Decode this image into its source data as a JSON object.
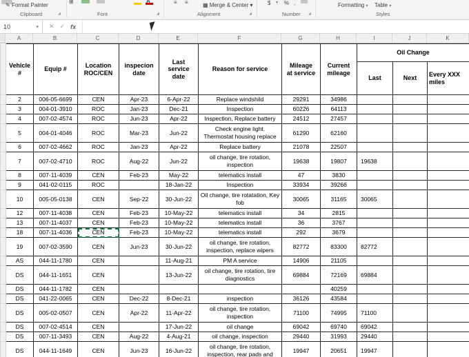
{
  "colors": {
    "copy_border": "#107c41",
    "grid_border": "#262626"
  },
  "ribbon": {
    "format_painter": "Format Painter",
    "merge_center": "Merge & Center",
    "formatting": "Formatting",
    "table_btn": "Table",
    "groups": {
      "clipboard": "Clipboard",
      "font": "Font",
      "alignment": "Alignment",
      "number": "Number",
      "styles": "Styles"
    },
    "icons": {
      "brush": "✎",
      "caret": "▾",
      "merge": "▦",
      "borders": "⊞",
      "align": "≡",
      "currency": "$",
      "percent": "%",
      "comma": ",",
      "launcher": "◢",
      "font_color": "A"
    }
  },
  "formula_bar": {
    "name_box": "10",
    "cancel": "✕",
    "enter": "✓",
    "fx": "fx"
  },
  "columns": [
    "A",
    "B",
    "C",
    "D",
    "E",
    "F",
    "G",
    "H",
    "I",
    "J",
    "K"
  ],
  "table": {
    "headers": {
      "vehicle": "Vehicle #",
      "equip": "Equip #",
      "location": "Location\nROC/CEN",
      "inspection": "inspecion\ndate",
      "last_service": "Last\nservice\ndate",
      "reason": "Reason for service",
      "mileage_at_service": "Mileage\nat service",
      "current_mileage": "Current\nmileage",
      "oil_change": "Oil Change",
      "oil_last": "Last",
      "oil_next": "Next",
      "oil_every": "Every XXX\nmiles"
    },
    "rows": [
      {
        "vehicle": "2",
        "equip": "006-05-6699",
        "location": "CEN",
        "inspection": "Apr-23",
        "last_service": "6-Apr-22",
        "reason": "Replace windshild",
        "mileage_at_service": "29291",
        "current_mileage": "34986",
        "oil_last": "",
        "oil_next": "",
        "oil_every": "",
        "tall": false
      },
      {
        "vehicle": "3",
        "equip": "004-01-3910",
        "location": "ROC",
        "inspection": "Jan-23",
        "last_service": "Dec-21",
        "reason": "Inspection",
        "mileage_at_service": "60226",
        "current_mileage": "64113",
        "oil_last": "",
        "oil_next": "",
        "oil_every": "",
        "tall": false
      },
      {
        "vehicle": "4",
        "equip": "007-02-4574",
        "location": "ROC",
        "inspection": "Jun-23",
        "last_service": "Apr-22",
        "reason": "Inspection, Replace battery",
        "mileage_at_service": "24512",
        "current_mileage": "27457",
        "oil_last": "",
        "oil_next": "",
        "oil_every": "",
        "tall": false
      },
      {
        "vehicle": "5",
        "equip": "004-01-4046",
        "location": "ROC",
        "inspection": "Mar-23",
        "last_service": "Jun-22",
        "reason": "Check engine light. Thermostat housing replace",
        "mileage_at_service": "61290",
        "current_mileage": "62160",
        "oil_last": "",
        "oil_next": "",
        "oil_every": "",
        "tall": true
      },
      {
        "vehicle": "6",
        "equip": "007-02-4662",
        "location": "ROC",
        "inspection": "Jan-23",
        "last_service": "Apr-22",
        "reason": "Replace battery",
        "mileage_at_service": "21078",
        "current_mileage": "22507",
        "oil_last": "",
        "oil_next": "",
        "oil_every": "",
        "tall": false
      },
      {
        "vehicle": "7",
        "equip": "007-02-4710",
        "location": "ROC",
        "inspection": "Aug-22",
        "last_service": "Jun-22",
        "reason": "oil change, tire rotation, inspection",
        "mileage_at_service": "19638",
        "current_mileage": "19807",
        "oil_last": "19638",
        "oil_next": "",
        "oil_every": "",
        "tall": true
      },
      {
        "vehicle": "8",
        "equip": "007-11-4039",
        "location": "CEN",
        "inspection": "Feb-23",
        "last_service": "May-22",
        "reason": "telematics install",
        "mileage_at_service": "47",
        "current_mileage": "3830",
        "oil_last": "",
        "oil_next": "",
        "oil_every": "",
        "tall": false
      },
      {
        "vehicle": "9",
        "equip": "041-02-0115",
        "location": "ROC",
        "inspection": "",
        "last_service": "18-Jan-22",
        "reason": "Inspection",
        "mileage_at_service": "33934",
        "current_mileage": "39266",
        "oil_last": "",
        "oil_next": "",
        "oil_every": "",
        "tall": false
      },
      {
        "vehicle": "10",
        "equip": "005-05-0138",
        "location": "CEN",
        "inspection": "Sep-22",
        "last_service": "30-Jun-22",
        "reason": "Oil change, tire rotatation, Key fob",
        "mileage_at_service": "30065",
        "current_mileage": "31165",
        "oil_last": "30065",
        "oil_next": "",
        "oil_every": "",
        "tall": true
      },
      {
        "vehicle": "12",
        "equip": "007-11-4038",
        "location": "CEN",
        "inspection": "Feb-23",
        "last_service": "10-May-22",
        "reason": "telematics install",
        "mileage_at_service": "34",
        "current_mileage": "2815",
        "oil_last": "",
        "oil_next": "",
        "oil_every": "",
        "tall": false
      },
      {
        "vehicle": "13",
        "equip": "007-11-4037",
        "location": "CEN",
        "inspection": "Feb-23",
        "last_service": "10-May-22",
        "reason": "telematics install",
        "mileage_at_service": "36",
        "current_mileage": "3767",
        "oil_last": "",
        "oil_next": "",
        "oil_every": "",
        "tall": false
      },
      {
        "vehicle": "18",
        "equip": "007-11-4036",
        "location": "CEN",
        "inspection": "Feb-23",
        "last_service": "10-May-22",
        "reason": "telematics install",
        "mileage_at_service": "292",
        "current_mileage": "3679",
        "oil_last": "",
        "oil_next": "",
        "oil_every": "",
        "tall": false,
        "copied": "location"
      },
      {
        "vehicle": "19",
        "equip": "007-02-3590",
        "location": "CEN",
        "inspection": "Jun-23",
        "last_service": "30-Jun-22",
        "reason": "oil change, tire rotation, inspection, replace wipers",
        "mileage_at_service": "82772",
        "current_mileage": "83300",
        "oil_last": "82772",
        "oil_next": "",
        "oil_every": "",
        "tall": true
      },
      {
        "vehicle": "AS",
        "equip": "044-11-1780",
        "location": "CEN",
        "inspection": "",
        "last_service": "11-Aug-21",
        "reason": "PM A service",
        "mileage_at_service": "14906",
        "current_mileage": "21105",
        "oil_last": "",
        "oil_next": "",
        "oil_every": "",
        "tall": false
      },
      {
        "vehicle": "DS",
        "equip": "044-11-1651",
        "location": "CEN",
        "inspection": "",
        "last_service": "13-Jun-22",
        "reason": "oil change, tire rotation, tire diagnostics",
        "mileage_at_service": "69884",
        "current_mileage": "72169",
        "oil_last": "69884",
        "oil_next": "",
        "oil_every": "",
        "tall": true
      },
      {
        "vehicle": "DS",
        "equip": "044-11-1782",
        "location": "CEN",
        "inspection": "",
        "last_service": "",
        "reason": "",
        "mileage_at_service": "",
        "current_mileage": "40259",
        "oil_last": "",
        "oil_next": "",
        "oil_every": "",
        "tall": false
      },
      {
        "vehicle": "DS",
        "equip": "041-22-0065",
        "location": "CEN",
        "inspection": "Dec-22",
        "last_service": "8-Dec-21",
        "reason": "inspection",
        "mileage_at_service": "36126",
        "current_mileage": "43584",
        "oil_last": "",
        "oil_next": "",
        "oil_every": "",
        "tall": false
      },
      {
        "vehicle": "DS",
        "equip": "005-02-0507",
        "location": "CEN",
        "inspection": "Apr-22",
        "last_service": "11-Apr-22",
        "reason": "oil change, tire rotation, inspection",
        "mileage_at_service": "71100",
        "current_mileage": "74995",
        "oil_last": "71100",
        "oil_next": "",
        "oil_every": "",
        "tall": true
      },
      {
        "vehicle": "DS",
        "equip": "007-02-4514",
        "location": "CEN",
        "inspection": "",
        "last_service": "17-Jun-22",
        "reason": "oil change",
        "mileage_at_service": "69042",
        "current_mileage": "69740",
        "oil_last": "69042",
        "oil_next": "",
        "oil_every": "",
        "tall": false
      },
      {
        "vehicle": "DS",
        "equip": "007-11-3493",
        "location": "CEN",
        "inspection": "Aug-22",
        "last_service": "4-Aug-21",
        "reason": "oil change, inspection",
        "mileage_at_service": "29440",
        "current_mileage": "31993",
        "oil_last": "29440",
        "oil_next": "",
        "oil_every": "",
        "tall": false
      },
      {
        "vehicle": "DS",
        "equip": "044-11-1649",
        "location": "CEN",
        "inspection": "Jun-23",
        "last_service": "16-Jun-22",
        "reason": "oil change, tire rotation, inspection, rear pads and",
        "mileage_at_service": "19947",
        "current_mileage": "20651",
        "oil_last": "19947",
        "oil_next": "",
        "oil_every": "",
        "tall": true
      }
    ]
  }
}
